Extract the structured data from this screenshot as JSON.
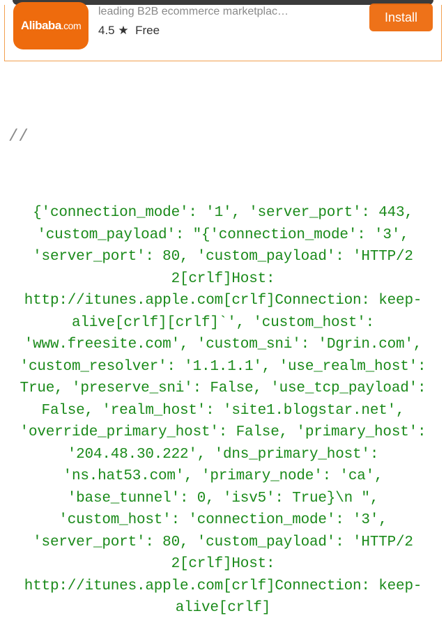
{
  "ad": {
    "brand_main": "Alibaba",
    "brand_suffix": ".com",
    "description": "leading B2B ecommerce marketplac…",
    "rating": "4.5",
    "star": "★",
    "price": "Free",
    "install_label": "Install"
  },
  "code": {
    "comment": "//",
    "body": "{'connection_mode': '1', 'server_port': 443, 'custom_payload': \"{'connection_mode': '3', 'server_port': 80, 'custom_payload': 'HTTP/2 2[crlf]Host: http://itunes.apple.com[crlf]Connection: keep-alive[crlf][crlf]`', 'custom_host': 'www.freesite.com', 'custom_sni': 'Dgrin.com', 'custom_resolver': '1.1.1.1', 'use_realm_host': True, 'preserve_sni': False, 'use_tcp_payload': False, 'realm_host': 'site1.blogstar.net', 'override_primary_host': False, 'primary_host': '204.48.30.222', 'dns_primary_host': 'ns.hat53.com', 'primary_node': 'ca', 'base_tunnel': 0, 'isv5': True}\\n \", 'custom_host': 'connection_mode': '3', 'server_port': 80, 'custom_payload': 'HTTP/2 2[crlf]Host: http://itunes.apple.com[crlf]Connection: keep-alive[crlf]"
  }
}
